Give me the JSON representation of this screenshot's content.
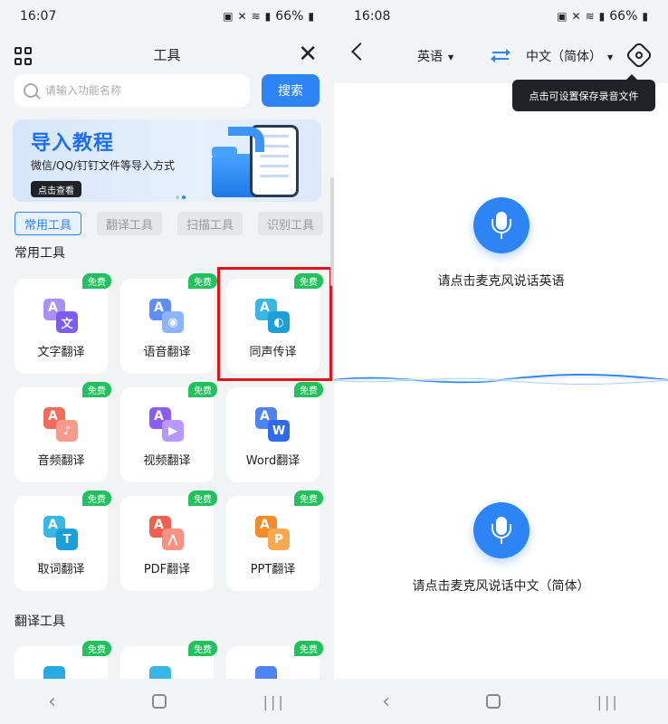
{
  "left": {
    "status": {
      "time": "16:07",
      "battery": "66%"
    },
    "title": "工具",
    "search": {
      "placeholder": "请输入功能名称",
      "button": "搜索"
    },
    "banner": {
      "title": "导入教程",
      "subtitle": "微信/QQ/钉钉文件等导入方式",
      "button": "点击查看"
    },
    "chips": [
      "常用工具",
      "翻译工具",
      "扫描工具",
      "识别工具"
    ],
    "section_common": "常用工具",
    "section_translate": "翻译工具",
    "free_badge": "免费",
    "tools": [
      {
        "label": "文字翻译",
        "glyph": "文"
      },
      {
        "label": "语音翻译",
        "glyph": "◉"
      },
      {
        "label": "同声传译",
        "glyph": "◐"
      },
      {
        "label": "音频翻译",
        "glyph": "♪"
      },
      {
        "label": "视频翻译",
        "glyph": "▶"
      },
      {
        "label": "Word翻译",
        "glyph": "W"
      },
      {
        "label": "取词翻译",
        "glyph": "T"
      },
      {
        "label": "PDF翻译",
        "glyph": "⋀"
      },
      {
        "label": "PPT翻译",
        "glyph": "P"
      }
    ]
  },
  "right": {
    "status": {
      "time": "16:08",
      "battery": "66%"
    },
    "source_lang": "英语",
    "target_lang": "中文（简体）",
    "tooltip": "点击可设置保存录音文件",
    "prompt_source": "请点击麦克风说话英语",
    "prompt_target": "请点击麦克风说话中文（简体）"
  },
  "colors": {
    "accent": "#2d84f5",
    "free": "#22c15e",
    "highlight": "#e0141b"
  }
}
